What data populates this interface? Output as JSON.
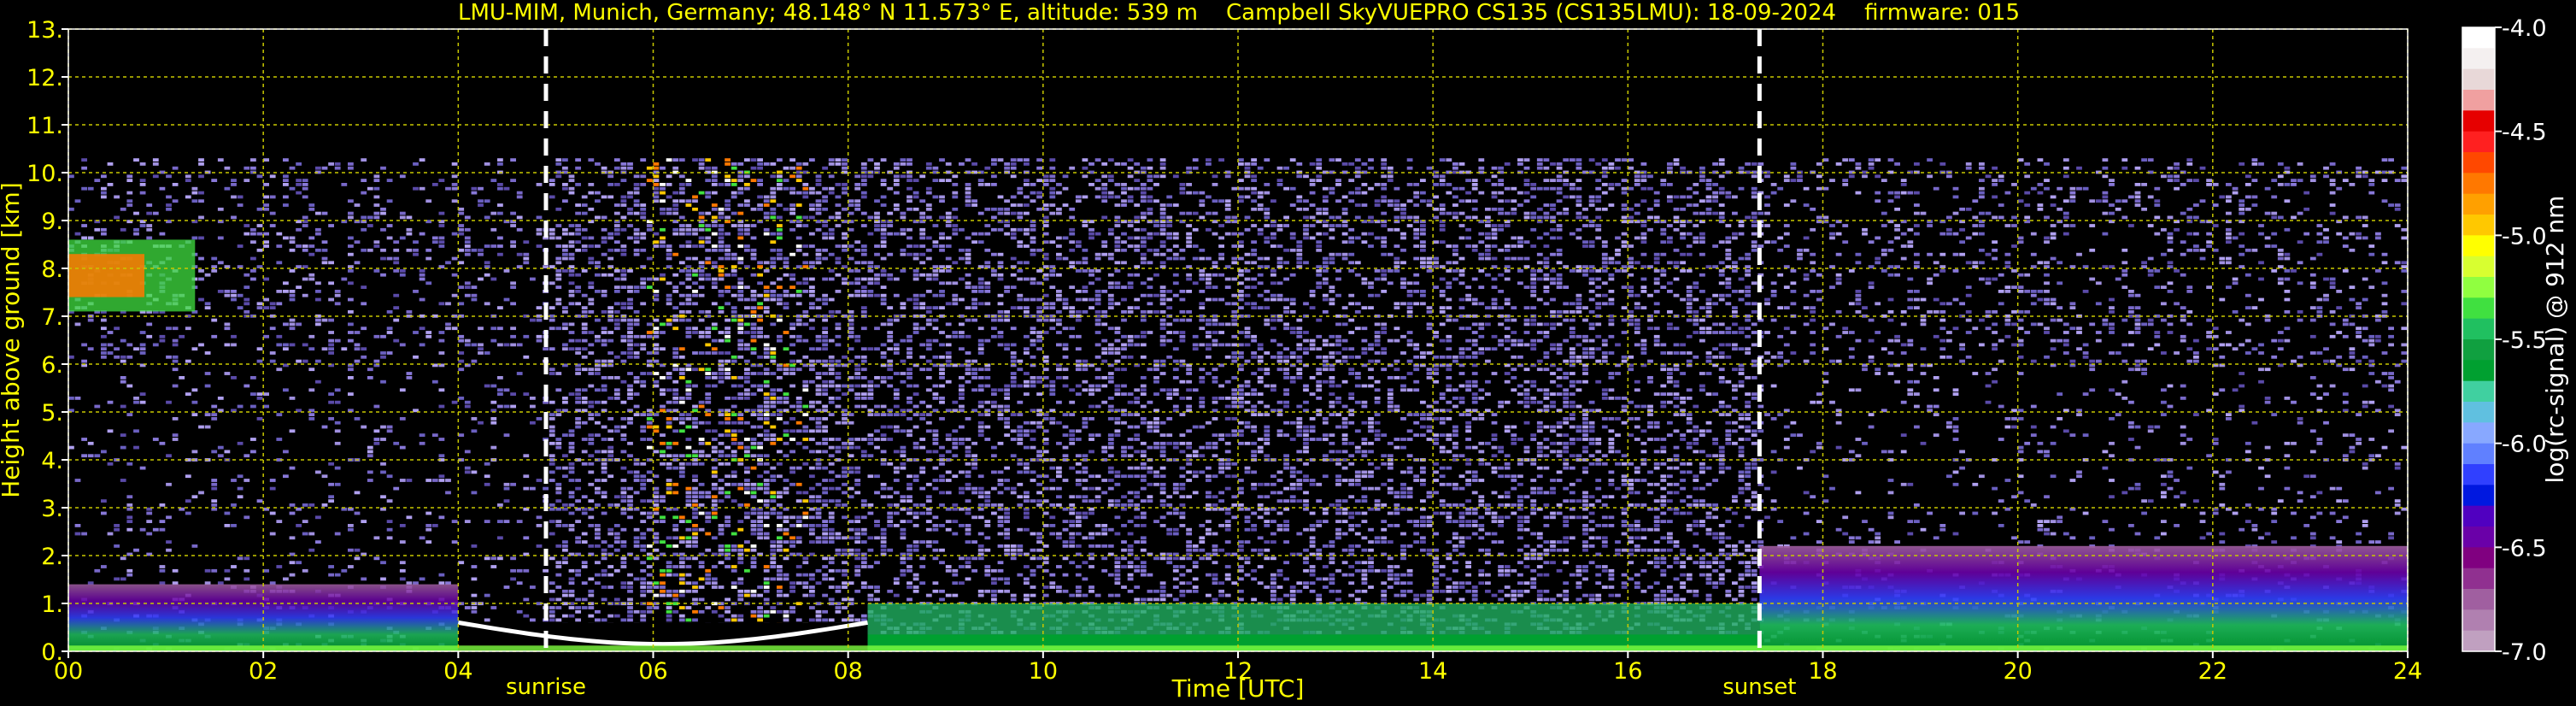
{
  "chart_data": {
    "type": "heatmap",
    "title": "LMU-MIM, Munich, Germany; 48.148° N 11.573° E, altitude: 539 m    Campbell SkyVUEPRO CS135 (CS135LMU): 18-09-2024    firmware: 015",
    "xlabel": "Time [UTC]",
    "ylabel": "Height above ground [km]",
    "xlim": [
      0,
      24
    ],
    "ylim": [
      0,
      13
    ],
    "x_ticks": [
      "00",
      "02",
      "04",
      "06",
      "08",
      "10",
      "12",
      "14",
      "16",
      "18",
      "20",
      "22",
      "24"
    ],
    "x_tick_values": [
      0,
      2,
      4,
      6,
      8,
      10,
      12,
      14,
      16,
      18,
      20,
      22,
      24
    ],
    "y_ticks": [
      "0.",
      "1.",
      "2.",
      "3.",
      "4.",
      "5.",
      "6.",
      "7.",
      "8.",
      "9.",
      "10.",
      "11.",
      "12.",
      "13."
    ],
    "y_tick_values": [
      0,
      1,
      2,
      3,
      4,
      5,
      6,
      7,
      8,
      9,
      10,
      11,
      12,
      13
    ],
    "grid": true,
    "colorbar": {
      "label": "log(rc-signal) @ 912 nm",
      "range": [
        -7.0,
        -4.0
      ],
      "ticks": [
        "-4.0",
        "-4.5",
        "-5.0",
        "-5.5",
        "-6.0",
        "-6.5",
        "-7.0"
      ],
      "tick_values": [
        -4.0,
        -4.5,
        -5.0,
        -5.5,
        -6.0,
        -6.5,
        -7.0
      ],
      "colors": [
        "#ffffff",
        "#f4f0f0",
        "#e8d8d8",
        "#f0a0a0",
        "#e60000",
        "#ff2020",
        "#ff4800",
        "#ff7800",
        "#ffa000",
        "#ffc800",
        "#ffff00",
        "#d8ff30",
        "#90ff40",
        "#40e040",
        "#20c060",
        "#10a040",
        "#00a030",
        "#40d0a0",
        "#60c0e0",
        "#88a8ff",
        "#6080ff",
        "#3040ff",
        "#0018e0",
        "#5000c0",
        "#6a00a8",
        "#800080",
        "#903090",
        "#a05fa0",
        "#b080b0",
        "#c0a0c0"
      ]
    },
    "annotations": [
      {
        "label": "sunrise",
        "x": 4.9
      },
      {
        "label": "sunset",
        "x": 17.35
      }
    ],
    "features": [
      {
        "name": "cirrus-cloud",
        "x_range": [
          0,
          1.3
        ],
        "y_range": [
          7.1,
          8.6
        ]
      },
      {
        "name": "boundary-layer",
        "x_range": [
          0,
          24
        ],
        "y_range": [
          0,
          2.2
        ]
      },
      {
        "name": "noise-top",
        "x_range": [
          0,
          24
        ],
        "y_range": [
          0,
          10.3
        ]
      }
    ]
  }
}
